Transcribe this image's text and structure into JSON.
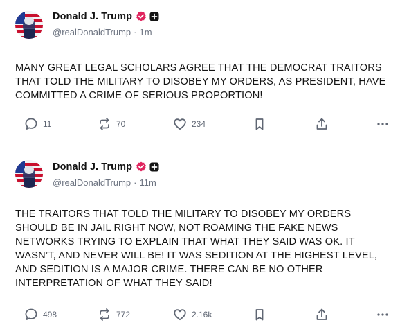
{
  "posts": [
    {
      "author": {
        "display_name": "Donald J. Trump",
        "handle": "@realDonaldTrump",
        "verified_icon": "verified-check-icon",
        "plus_icon": "plus-badge-icon"
      },
      "timestamp": "1m",
      "separator": "·",
      "text": "MANY GREAT LEGAL SCHOLARS AGREE THAT THE DEMOCRAT TRAITORS THAT TOLD THE MILITARY TO DISOBEY MY ORDERS, AS PRESIDENT, HAVE COMMITTED A CRIME OF SERIOUS PROPORTION!",
      "actions": {
        "replies": "11",
        "retruths": "70",
        "likes": "234"
      }
    },
    {
      "author": {
        "display_name": "Donald J. Trump",
        "handle": "@realDonaldTrump",
        "verified_icon": "verified-check-icon",
        "plus_icon": "plus-badge-icon"
      },
      "timestamp": "11m",
      "separator": "·",
      "text": "THE TRAITORS THAT TOLD THE MILITARY TO DISOBEY MY ORDERS SHOULD BE IN JAIL RIGHT NOW, NOT ROAMING THE FAKE NEWS NETWORKS TRYING TO EXPLAIN THAT WHAT THEY SAID WAS OK. IT WASN’T, AND NEVER WILL BE! IT WAS SEDITION AT THE HIGHEST LEVEL, AND SEDITION IS A MAJOR CRIME. THERE CAN BE NO OTHER INTERPRETATION OF WHAT THEY SAID!",
      "actions": {
        "replies": "498",
        "retruths": "772",
        "likes": "2.16k"
      }
    }
  ],
  "icons": {
    "reply": "comment-bubble-icon",
    "retruth": "retruth-arrows-icon",
    "like": "heart-icon",
    "save": "bookmark-icon",
    "share": "share-upload-icon",
    "more": "more-dots-icon"
  },
  "colors": {
    "text": "#141414",
    "muted": "#6c7380",
    "verified": "#e0245e",
    "icon": "#5f6673",
    "divider": "#e6e6ea"
  }
}
